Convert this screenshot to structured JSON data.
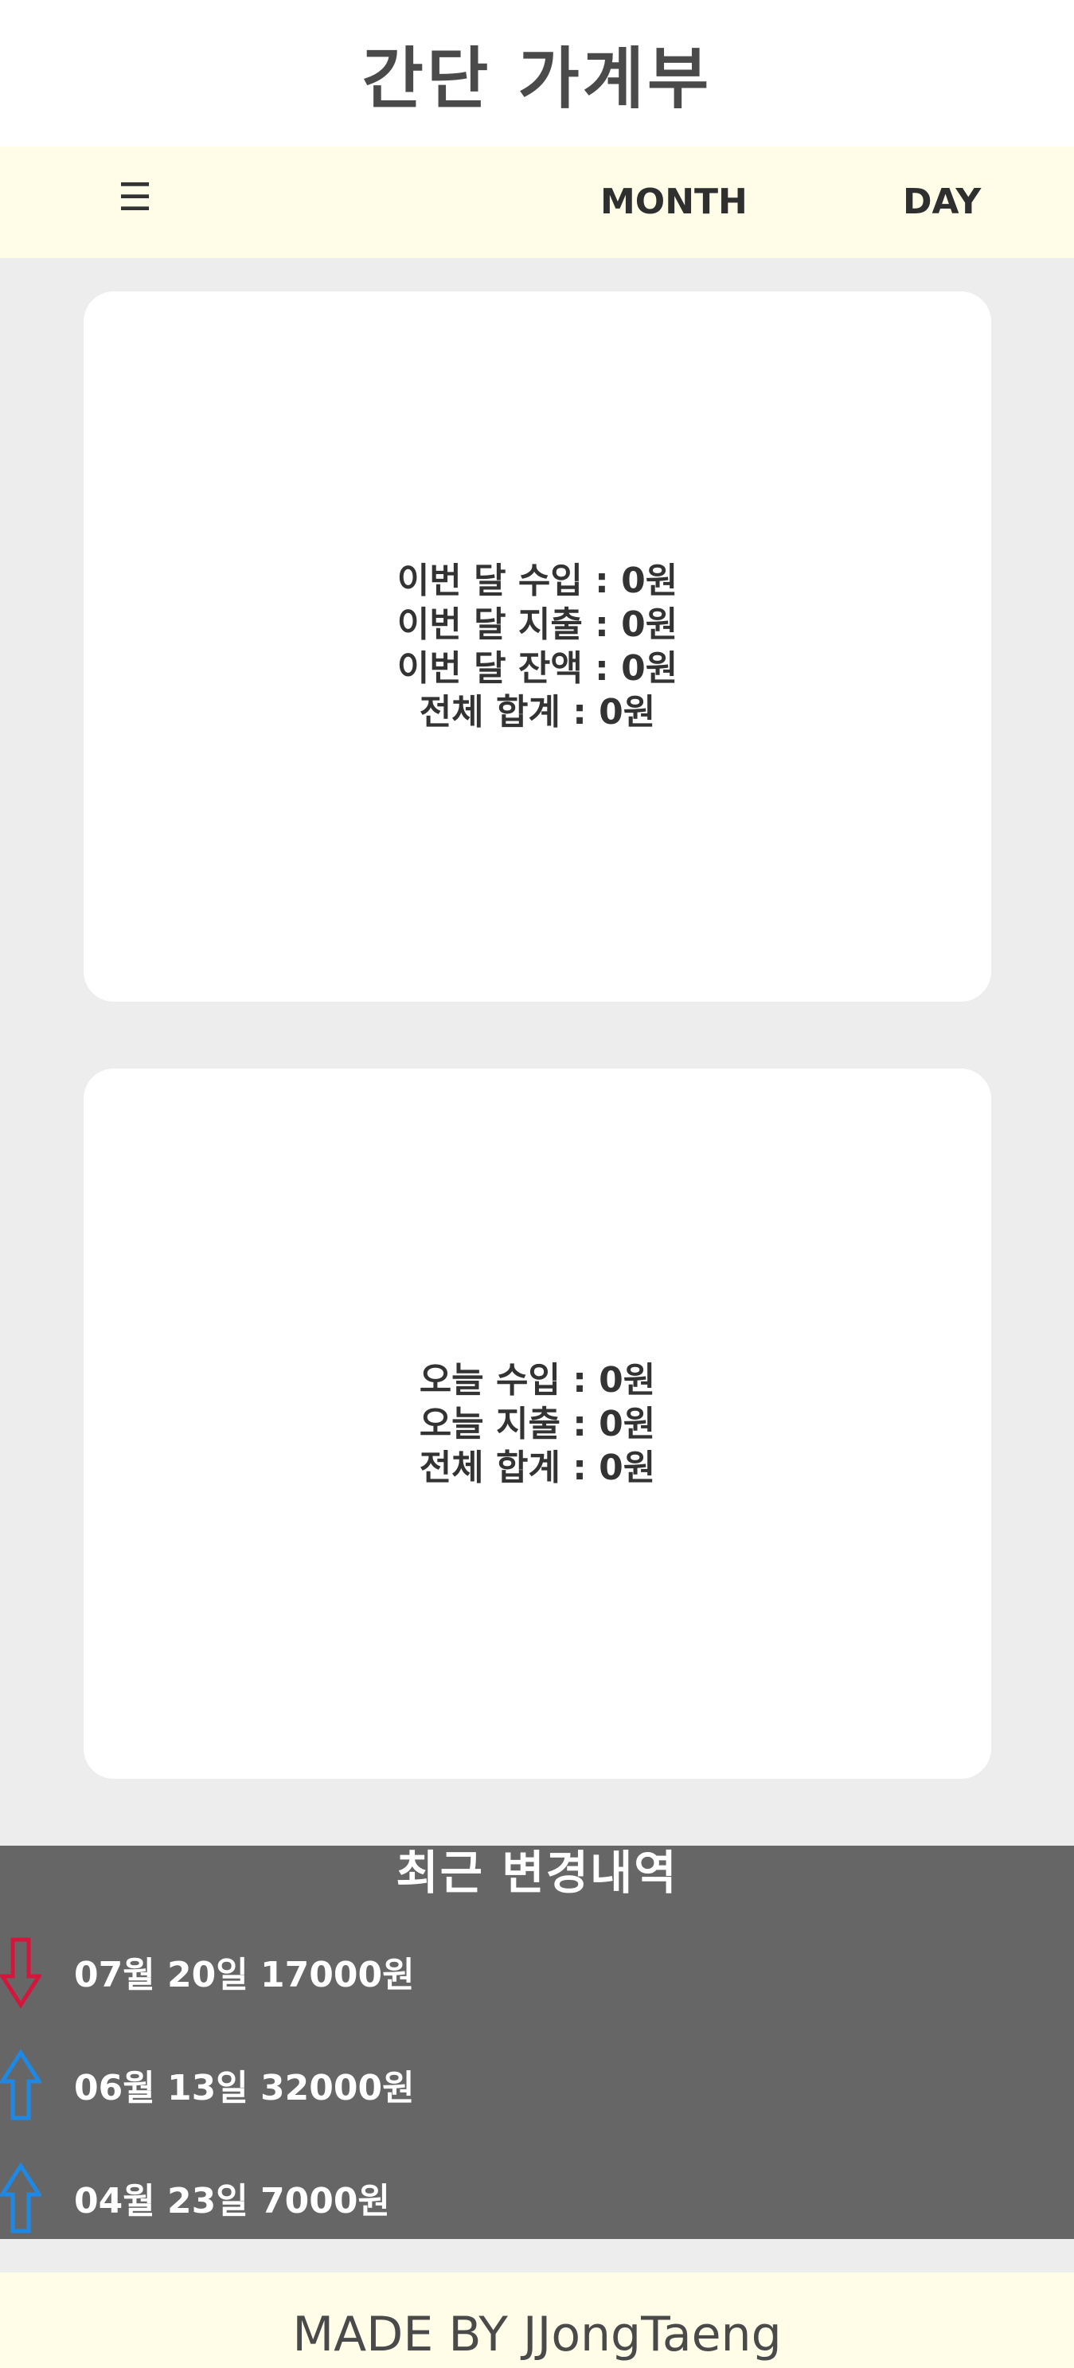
{
  "header": {
    "title": "간단 가계부"
  },
  "nav": {
    "menu_icon": "☰",
    "month_label": "MONTH",
    "day_label": "DAY"
  },
  "month_card": {
    "income": "이번 달 수입 : 0원",
    "expense": "이번 달 지출 : 0원",
    "balance": "이번 달 잔액 : 0원",
    "total": "전체 합계 : 0원"
  },
  "day_card": {
    "income": "오늘 수입 : 0원",
    "expense": "오늘 지출 : 0원",
    "total": "전체 합계 : 0원"
  },
  "recent": {
    "title": "최근 변경내역",
    "items": [
      {
        "text": "07월 20일 17000원",
        "direction": "down",
        "icon": "arrow-down-icon",
        "color": "#d4163c"
      },
      {
        "text": "06월 13일 32000원",
        "direction": "up",
        "icon": "arrow-up-icon",
        "color": "#1e88e5"
      },
      {
        "text": "04월 23일 7000원",
        "direction": "up",
        "icon": "arrow-up-icon",
        "color": "#1e88e5"
      }
    ]
  },
  "footer": {
    "text": "MADE BY JJongTaeng"
  },
  "colors": {
    "nav_background": "#fffde8",
    "page_background": "#ededed",
    "recent_background": "#666666",
    "expense_arrow": "#d4163c",
    "income_arrow": "#1e88e5"
  }
}
